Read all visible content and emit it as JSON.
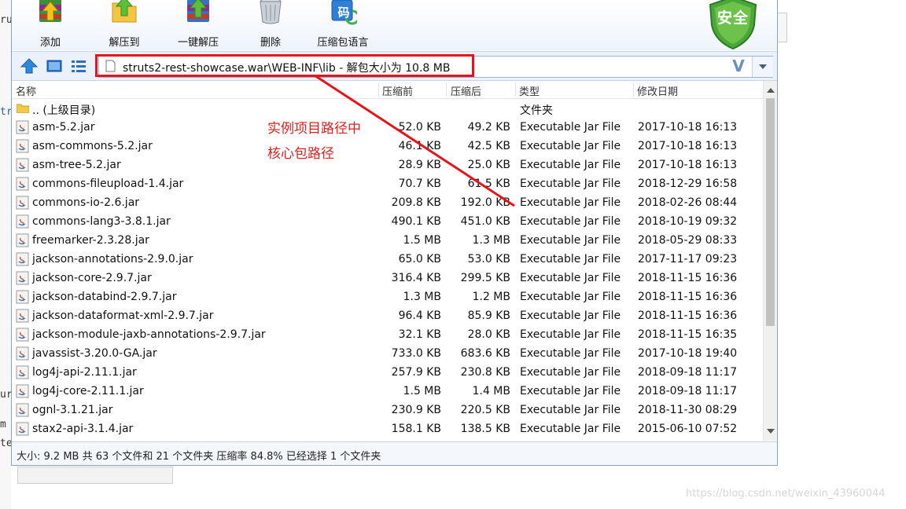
{
  "toolbar": {
    "buttons": [
      {
        "label": "添加",
        "icon": "add-archive-icon"
      },
      {
        "label": "解压到",
        "icon": "extract-to-icon"
      },
      {
        "label": "一键解压",
        "icon": "one-click-extract-icon"
      },
      {
        "label": "删除",
        "icon": "delete-trash-icon"
      },
      {
        "label": "压缩包语言",
        "icon": "archive-language-icon"
      }
    ],
    "icon_glyph_lang": "码",
    "security_badge": "安全"
  },
  "address": {
    "path": "struts2-rest-showcase.war\\WEB-INF\\lib - 解包大小为 10.8 MB"
  },
  "columns": {
    "name": "名称",
    "packed_before": "压缩前",
    "packed_after": "压缩后",
    "type": "类型",
    "modified": "修改日期"
  },
  "files": [
    {
      "name": ".. (上级目录)",
      "size": "",
      "packed": "",
      "type": "文件夹",
      "date": "",
      "kind": "folder"
    },
    {
      "name": "asm-5.2.jar",
      "size": "52.0 KB",
      "packed": "49.2 KB",
      "type": "Executable Jar File",
      "date": "2017-10-18 16:13",
      "kind": "jar"
    },
    {
      "name": "asm-commons-5.2.jar",
      "size": "46.1 KB",
      "packed": "42.5 KB",
      "type": "Executable Jar File",
      "date": "2017-10-18 16:13",
      "kind": "jar"
    },
    {
      "name": "asm-tree-5.2.jar",
      "size": "28.9 KB",
      "packed": "25.0 KB",
      "type": "Executable Jar File",
      "date": "2017-10-18 16:13",
      "kind": "jar"
    },
    {
      "name": "commons-fileupload-1.4.jar",
      "size": "70.7 KB",
      "packed": "61.5 KB",
      "type": "Executable Jar File",
      "date": "2018-12-29 16:58",
      "kind": "jar"
    },
    {
      "name": "commons-io-2.6.jar",
      "size": "209.8 KB",
      "packed": "192.0 KB",
      "type": "Executable Jar File",
      "date": "2018-02-26 08:44",
      "kind": "jar"
    },
    {
      "name": "commons-lang3-3.8.1.jar",
      "size": "490.1 KB",
      "packed": "451.0 KB",
      "type": "Executable Jar File",
      "date": "2018-10-19 09:32",
      "kind": "jar"
    },
    {
      "name": "freemarker-2.3.28.jar",
      "size": "1.5 MB",
      "packed": "1.3 MB",
      "type": "Executable Jar File",
      "date": "2018-05-29 08:33",
      "kind": "jar"
    },
    {
      "name": "jackson-annotations-2.9.0.jar",
      "size": "65.0 KB",
      "packed": "53.0 KB",
      "type": "Executable Jar File",
      "date": "2017-11-17 09:23",
      "kind": "jar"
    },
    {
      "name": "jackson-core-2.9.7.jar",
      "size": "316.4 KB",
      "packed": "299.5 KB",
      "type": "Executable Jar File",
      "date": "2018-11-15 16:36",
      "kind": "jar"
    },
    {
      "name": "jackson-databind-2.9.7.jar",
      "size": "1.3 MB",
      "packed": "1.2 MB",
      "type": "Executable Jar File",
      "date": "2018-11-15 16:36",
      "kind": "jar"
    },
    {
      "name": "jackson-dataformat-xml-2.9.7.jar",
      "size": "96.4 KB",
      "packed": "85.9 KB",
      "type": "Executable Jar File",
      "date": "2018-11-15 16:36",
      "kind": "jar"
    },
    {
      "name": "jackson-module-jaxb-annotations-2.9.7.jar",
      "size": "32.1 KB",
      "packed": "28.0 KB",
      "type": "Executable Jar File",
      "date": "2018-11-15 16:35",
      "kind": "jar"
    },
    {
      "name": "javassist-3.20.0-GA.jar",
      "size": "733.0 KB",
      "packed": "683.6 KB",
      "type": "Executable Jar File",
      "date": "2017-10-18 19:40",
      "kind": "jar"
    },
    {
      "name": "log4j-api-2.11.1.jar",
      "size": "257.9 KB",
      "packed": "230.8 KB",
      "type": "Executable Jar File",
      "date": "2018-09-18 11:17",
      "kind": "jar"
    },
    {
      "name": "log4j-core-2.11.1.jar",
      "size": "1.5 MB",
      "packed": "1.4 MB",
      "type": "Executable Jar File",
      "date": "2018-09-18 11:17",
      "kind": "jar"
    },
    {
      "name": "ognl-3.1.21.jar",
      "size": "230.9 KB",
      "packed": "220.5 KB",
      "type": "Executable Jar File",
      "date": "2018-11-30 08:29",
      "kind": "jar"
    },
    {
      "name": "stax2-api-3.1.4.jar",
      "size": "158.1 KB",
      "packed": "138.5 KB",
      "type": "Executable Jar File",
      "date": "2015-06-10 07:52",
      "kind": "jar"
    }
  ],
  "status": "大小: 9.2 MB 共 63 个文件和 21 个文件夹 压缩率 84.8% 已经选择 1 个文件夹",
  "annotation": {
    "line1": "实例项目路径中",
    "line2": "核心包路径",
    "color": "#e8131a"
  },
  "background_fragments": [
    "ru",
    "",
    "tr",
    "ur",
    "m",
    "te"
  ],
  "watermark": "https://blog.csdn.net/weixin_43960044"
}
